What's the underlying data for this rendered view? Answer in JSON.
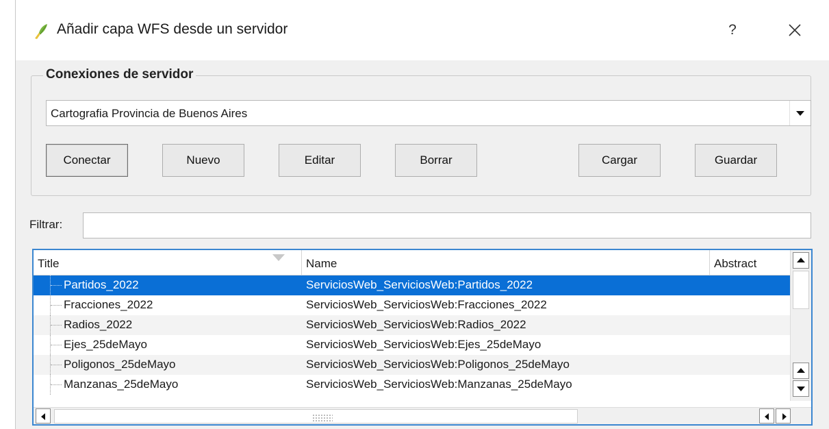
{
  "window": {
    "title": "Añadir capa WFS desde un servidor",
    "help_label": "?"
  },
  "connections": {
    "group_label": "Conexiones de servidor",
    "selected": "Cartografia Provincia de Buenos Aires",
    "buttons": {
      "connect": "Conectar",
      "new": "Nuevo",
      "edit": "Editar",
      "delete": "Borrar",
      "load": "Cargar",
      "save": "Guardar"
    }
  },
  "filter": {
    "label": "Filtrar:",
    "value": ""
  },
  "table": {
    "columns": [
      "Title",
      "Name",
      "Abstract"
    ],
    "rows": [
      {
        "title": "Partidos_2022",
        "name": "ServiciosWeb_ServiciosWeb:Partidos_2022"
      },
      {
        "title": "Fracciones_2022",
        "name": "ServiciosWeb_ServiciosWeb:Fracciones_2022"
      },
      {
        "title": "Radios_2022",
        "name": "ServiciosWeb_ServiciosWeb:Radios_2022"
      },
      {
        "title": "Ejes_25deMayo",
        "name": "ServiciosWeb_ServiciosWeb:Ejes_25deMayo"
      },
      {
        "title": "Poligonos_25deMayo",
        "name": "ServiciosWeb_ServiciosWeb:Poligonos_25deMayo"
      },
      {
        "title": "Manzanas_25deMayo",
        "name": "ServiciosWeb_ServiciosWeb:Manzanas_25deMayo"
      }
    ]
  },
  "colors": {
    "selection": "#0a6fd6",
    "focus_border": "#3a86d0",
    "dialog_bg": "#f0f0f0"
  },
  "icons": {
    "app": "qgis-logo-icon",
    "close": "close-icon",
    "dropdown": "chevron-down-icon",
    "sort": "sort-indicator-icon"
  }
}
